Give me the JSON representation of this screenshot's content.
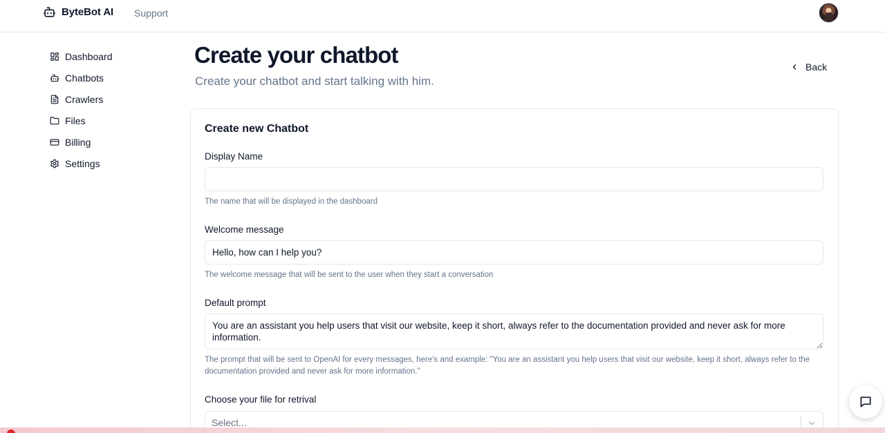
{
  "app": {
    "brand_name": "ByteBot AI",
    "brand_icon": "bot-icon",
    "support_label": "Support",
    "avatar": "user-avatar"
  },
  "sidebar": {
    "items": [
      {
        "label": "Dashboard",
        "icon": "dashboard-icon"
      },
      {
        "label": "Chatbots",
        "icon": "bot-icon"
      },
      {
        "label": "Crawlers",
        "icon": "file-text-icon"
      },
      {
        "label": "Files",
        "icon": "folder-icon"
      },
      {
        "label": "Billing",
        "icon": "credit-card-icon"
      },
      {
        "label": "Settings",
        "icon": "gear-icon"
      }
    ]
  },
  "header": {
    "title": "Create your chatbot",
    "subtitle": "Create your chatbot and start talking with him.",
    "back_label": "Back"
  },
  "form": {
    "card_title": "Create new Chatbot",
    "display_name": {
      "label": "Display Name",
      "value": "",
      "help": "The name that will be displayed in the dashboard"
    },
    "welcome_message": {
      "label": "Welcome message",
      "value": "Hello, how can I help you?",
      "help": "The welcome message that will be sent to the user when they start a conversation"
    },
    "default_prompt": {
      "label": "Default prompt",
      "value": "You are an assistant you help users that visit our website, keep it short, always refer to the documentation provided and never ask for more information.",
      "help": "The prompt that will be sent to OpenAI for every messages, here's and example: \"You are an assistant you help users that visit our website, keep it short, always refer to the documentation provided and never ask for more information.\""
    },
    "file_retrieval": {
      "label": "Choose your file for retrival",
      "placeholder": "Select..."
    }
  },
  "colors": {
    "text": "#0f172a",
    "muted": "#64748b",
    "border": "#e5e7eb"
  },
  "chat_fab": {
    "icon": "chat-bubble-icon"
  }
}
